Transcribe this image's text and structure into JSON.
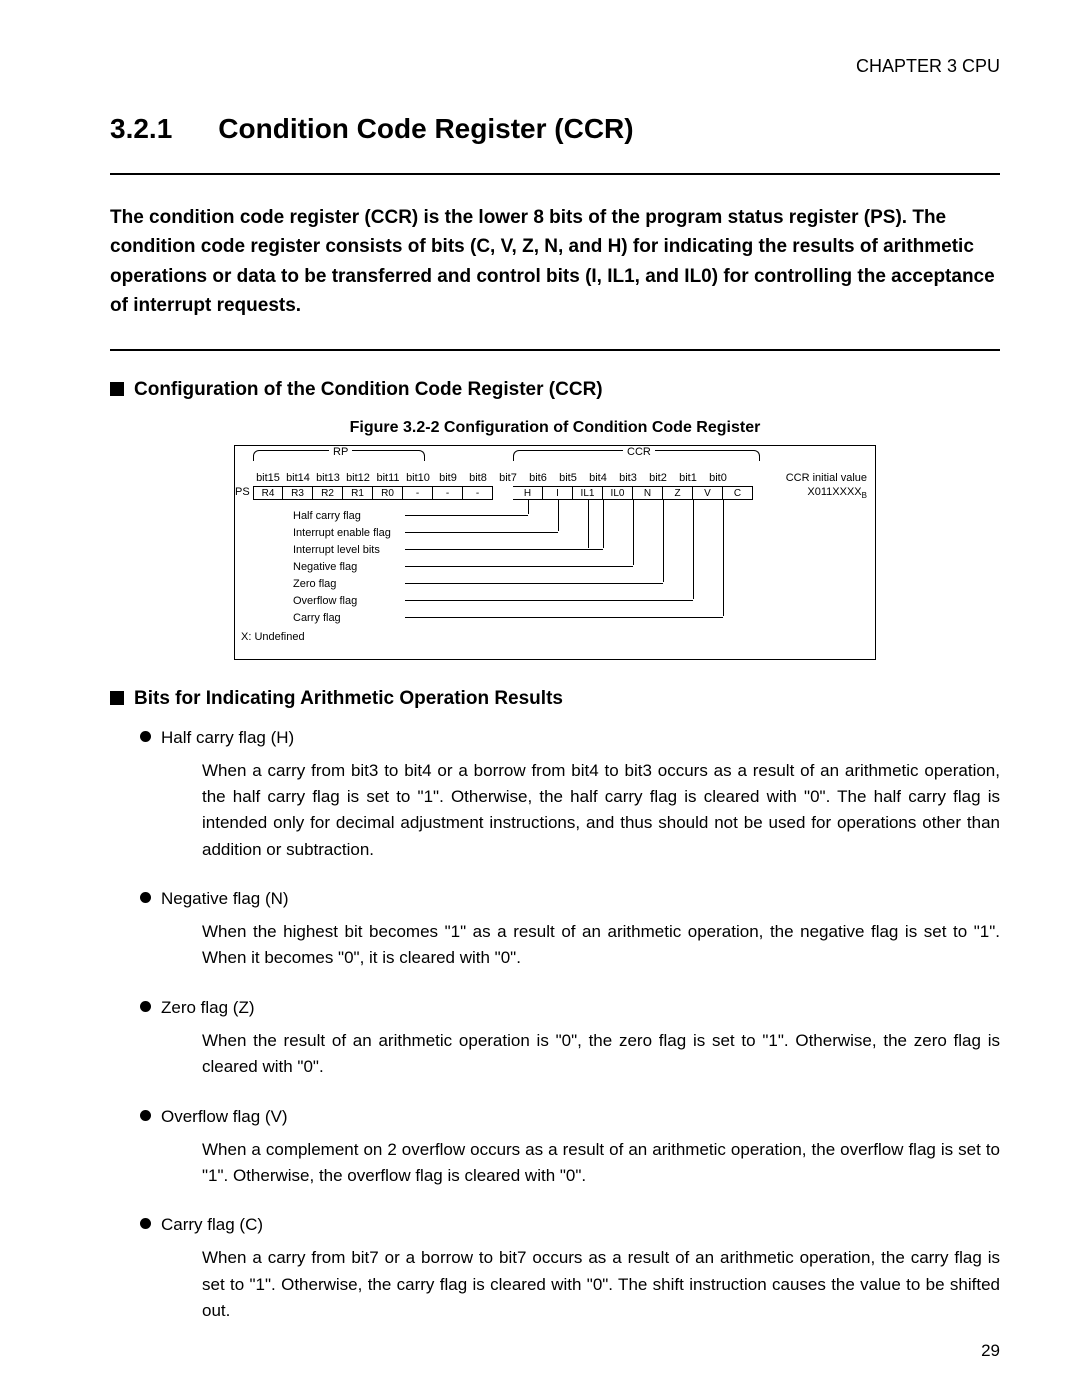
{
  "chapter": "CHAPTER 3  CPU",
  "section_number": "3.2.1",
  "section_title": "Condition Code Register (CCR)",
  "intro": "The condition code register (CCR) is the lower 8 bits of the program status register (PS). The condition code register consists of bits (C, V, Z, N, and H) for indicating the results of arithmetic operations or data to be transferred and control bits (I, IL1, and IL0) for controlling the acceptance of interrupt requests.",
  "h2_config": "Configuration of the Condition Code Register (CCR)",
  "fig": {
    "caption": "Figure 3.2-2  Configuration of Condition Code Register",
    "rp_label": "RP",
    "ccr_label": "CCR",
    "ps_label": "PS",
    "initial_label": "CCR initial value",
    "initial_value": "X011XXXX",
    "initial_value_sub": "B",
    "bits": [
      "bit15",
      "bit14",
      "bit13",
      "bit12",
      "bit11",
      "bit10",
      "bit9",
      "bit8",
      "bit7",
      "bit6",
      "bit5",
      "bit4",
      "bit3",
      "bit2",
      "bit1",
      "bit0"
    ],
    "cells": [
      "R4",
      "R3",
      "R2",
      "R1",
      "R0",
      "-",
      "-",
      "-",
      "H",
      "I",
      "IL1",
      "IL0",
      "N",
      "Z",
      "V",
      "C"
    ],
    "flags": {
      "half": "Half carry flag",
      "ien": "Interrupt enable flag",
      "ilvl": "Interrupt level bits",
      "neg": "Negative flag",
      "zero": "Zero flag",
      "ovf": "Overflow flag",
      "carry": "Carry flag"
    },
    "xnote": "X:  Undefined"
  },
  "h2_bits": "Bits for Indicating Arithmetic Operation Results",
  "items": {
    "half": {
      "title": "Half carry flag (H)",
      "body": "When a carry from bit3 to bit4 or a borrow from bit4 to bit3 occurs as a result of an arithmetic operation, the half carry flag is set to \"1\". Otherwise, the half carry flag is cleared with \"0\". The half carry flag is intended only for decimal adjustment instructions, and thus should not be used for operations other than addition or subtraction."
    },
    "neg": {
      "title": "Negative flag (N)",
      "body": "When the highest bit becomes \"1\" as a result of an arithmetic operation, the negative flag is set to \"1\". When it becomes \"0\", it is cleared with \"0\"."
    },
    "zero": {
      "title": "Zero flag (Z)",
      "body": "When the result of an arithmetic operation is \"0\", the zero flag is set to \"1\". Otherwise, the zero flag is cleared with \"0\"."
    },
    "ovf": {
      "title": "Overflow flag (V)",
      "body": "When a complement on 2 overflow occurs as a result of an arithmetic operation, the overflow flag is set to \"1\". Otherwise, the overflow flag is cleared with \"0\"."
    },
    "carry": {
      "title": "Carry flag (C)",
      "body": "When a carry from bit7 or a borrow to bit7 occurs as a result of an arithmetic operation, the carry flag is set to \"1\". Otherwise, the carry flag is cleared with \"0\". The shift instruction causes the value to be shifted out."
    }
  },
  "page_number": "29"
}
